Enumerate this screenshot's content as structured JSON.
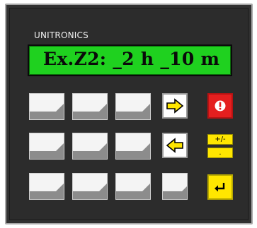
{
  "device": {
    "brand": "UNITRONICS",
    "display_text": "Ex.Z2: _2 h _10 m"
  },
  "keys": {
    "sign_label": "+/-",
    "decimal_label": "."
  },
  "icons": {
    "right_arrow": "right-arrow-icon",
    "left_arrow": "left-arrow-icon",
    "alarm": "exclamation-icon",
    "enter": "enter-icon"
  },
  "colors": {
    "display_bg": "#1fd11f",
    "alarm": "#e41f1f",
    "accent_yellow": "#ffe600",
    "panel": "#313131"
  }
}
